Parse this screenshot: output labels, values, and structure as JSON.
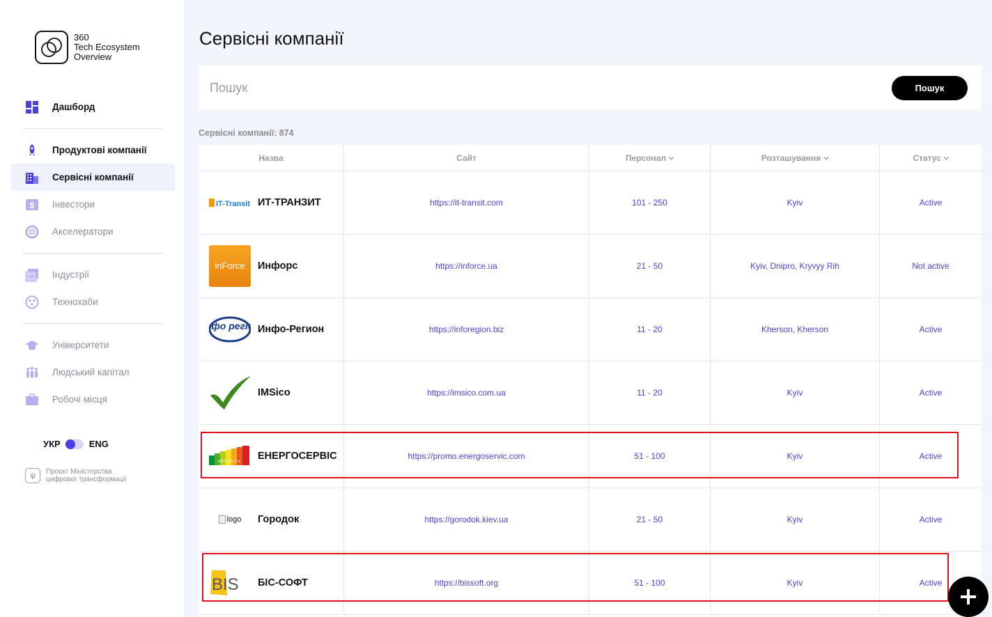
{
  "brand": {
    "line1": "360",
    "line2": "Tech Ecosystem",
    "line3": "Overview"
  },
  "sidebar": {
    "items": [
      {
        "label": "Дашборд",
        "icon": "dashboard-icon"
      },
      {
        "label": "Продуктові компанії",
        "icon": "rocket-icon"
      },
      {
        "label": "Сервісні компанії",
        "icon": "building-icon"
      },
      {
        "label": "Інвестори",
        "icon": "dollar-icon"
      },
      {
        "label": "Акселератори",
        "icon": "lifebuoy-icon"
      },
      {
        "label": "Індустрії",
        "icon": "gallery-icon"
      },
      {
        "label": "Технохаби",
        "icon": "hub-icon"
      },
      {
        "label": "Університети",
        "icon": "graduation-cap-icon"
      },
      {
        "label": "Людський капітал",
        "icon": "people-icon"
      },
      {
        "label": "Робочі місця",
        "icon": "briefcase-icon"
      }
    ],
    "lang_ukr": "УКР",
    "lang_eng": "ENG",
    "ministry_line1": "Проєкт Міністерства",
    "ministry_line2": "цифрової трансформації"
  },
  "page": {
    "title": "Сервісні компанії",
    "search_placeholder": "Пошук",
    "search_button": "Пошук",
    "count_label": "Сервісні компанії: 874"
  },
  "table": {
    "headers": [
      "Назва",
      "Сайт",
      "Персонал",
      "Розташування",
      "Статус"
    ],
    "rows": [
      {
        "name": "ИТ-ТРАНЗИТ",
        "site": "https://it-transit.com",
        "staff": "101 - 250",
        "location": "Kyiv",
        "status": "Active",
        "logo_text": "IT-Transit"
      },
      {
        "name": "Инфорс",
        "site": "https://inforce.ua",
        "staff": "21 - 50",
        "location": "Kyiv, Dnipro, Kryvyy Rih",
        "status": "Not active",
        "logo_text": "inForce"
      },
      {
        "name": "Инфо-Регион",
        "site": "https://inforegion.biz",
        "staff": "11 - 20",
        "location": "Kherson, Kherson",
        "status": "Active",
        "logo_text": "інфо регіон"
      },
      {
        "name": "IMSico",
        "site": "https://imsico.com.ua",
        "staff": "11 - 20",
        "location": "Kyiv",
        "status": "Active",
        "logo_text": ""
      },
      {
        "name": "ЕНЕРГОСЕРВІС",
        "site": "https://promo.energoservic.com",
        "staff": "51 - 100",
        "location": "Kyiv",
        "status": "Active",
        "logo_text": "A B C D E F G"
      },
      {
        "name": "Городок",
        "site": "https://gorodok.kiev.ua",
        "staff": "21 - 50",
        "location": "Kyiv",
        "status": "Active",
        "logo_text": "logo"
      },
      {
        "name": "БІС-СОФТ",
        "site": "https://bissoft.org",
        "staff": "51 - 100",
        "location": "Kyiv",
        "status": "Active",
        "logo_text": "BIS"
      }
    ]
  },
  "colors": {
    "accent": "#4b3fe0",
    "highlight": "#e0101a"
  }
}
